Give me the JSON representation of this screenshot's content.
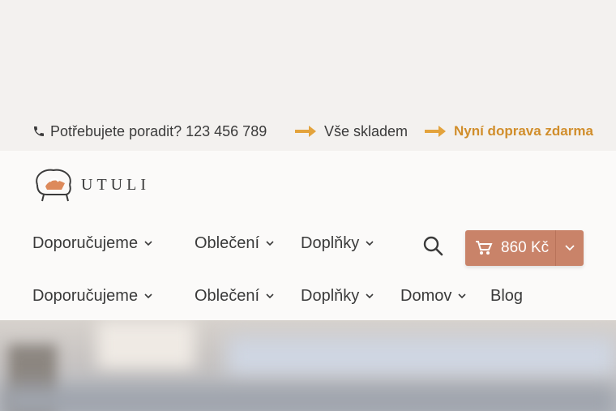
{
  "topbar": {
    "phone_text": "Potřebujete poradit? 123 456 789",
    "benefits": [
      "Vše skladem",
      "Nyní doprava zdarma"
    ]
  },
  "logo": {
    "text": "UTULI"
  },
  "nav_primary": {
    "items": [
      "Doporučujeme",
      "Oblečení",
      "Doplňky"
    ],
    "cart_total": "860 Kč"
  },
  "nav_secondary": {
    "items": [
      "Doporučujeme",
      "Oblečení",
      "Doplňky",
      "Domov",
      "Blog"
    ]
  },
  "colors": {
    "accent": "#d18e2b",
    "cart_button": "#c98369"
  }
}
